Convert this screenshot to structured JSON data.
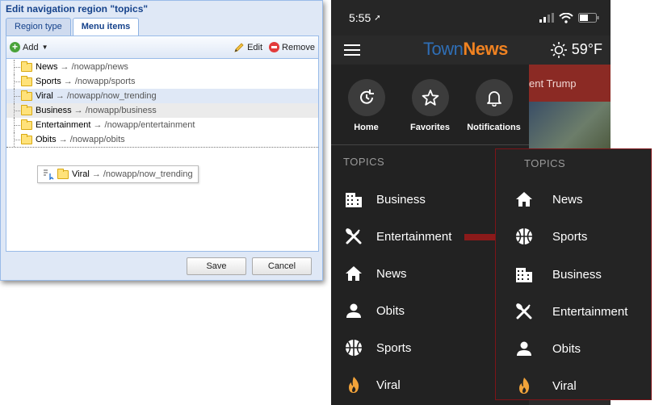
{
  "dialog": {
    "title": "Edit navigation region \"topics\"",
    "tabs": [
      "Region type",
      "Menu items"
    ],
    "toolbar": {
      "add": "Add",
      "edit": "Edit",
      "remove": "Remove"
    },
    "items": [
      {
        "label": "News",
        "path": "→ /nowapp/news"
      },
      {
        "label": "Sports",
        "path": "→ /nowapp/sports"
      },
      {
        "label": "Viral",
        "path": "→ /nowapp/now_trending"
      },
      {
        "label": "Business",
        "path": "→ /nowapp/business"
      },
      {
        "label": "Entertainment",
        "path": "→ /nowapp/entertainment"
      },
      {
        "label": "Obits",
        "path": "→ /nowapp/obits"
      }
    ],
    "drag": {
      "label": "Viral",
      "path": "→ /nowapp/now_trending"
    },
    "save": "Save",
    "cancel": "Cancel"
  },
  "phone": {
    "time": "5:55",
    "logo_a": "Town",
    "logo_b": "News",
    "temp": "59°F",
    "headline": "ent Trump",
    "quick": [
      "Home",
      "Favorites",
      "Notifications"
    ],
    "topics_heading": "TOPICS",
    "menu": [
      "Business",
      "Entertainment",
      "News",
      "Obits",
      "Sports",
      "Viral"
    ]
  },
  "reordered": {
    "topics_heading": "TOPICS",
    "menu": [
      "News",
      "Sports",
      "Business",
      "Entertainment",
      "Obits",
      "Viral"
    ]
  },
  "colors": {
    "accent_red": "#8b1a1a",
    "logo_blue": "#2f6eb5",
    "logo_orange": "#f08221"
  }
}
